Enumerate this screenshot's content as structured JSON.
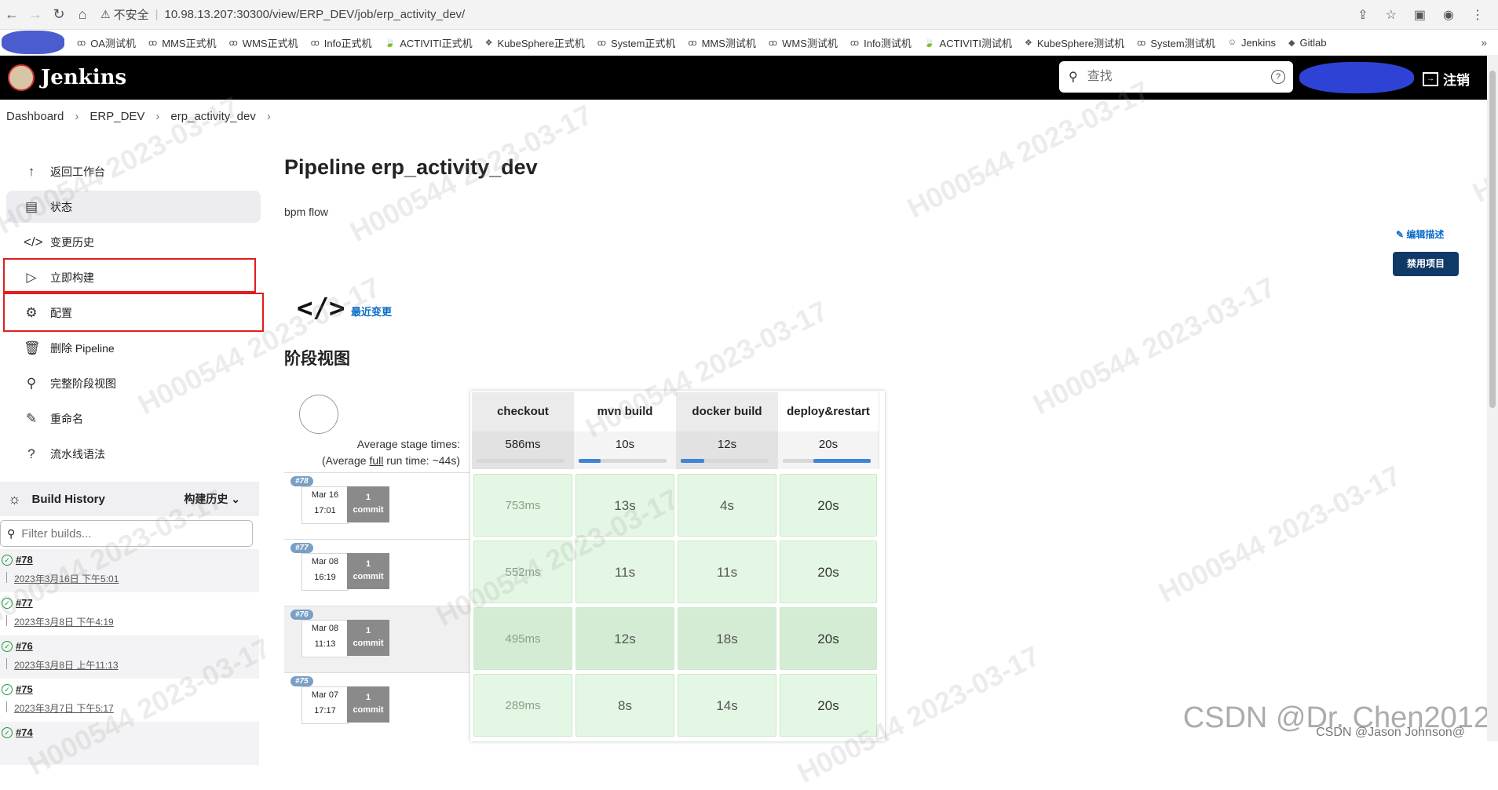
{
  "browser": {
    "insecure_label": "不安全",
    "url": "10.98.13.207:30300/view/ERP_DEV/job/erp_activity_dev/"
  },
  "bookmarks": [
    {
      "label": "OA测试机",
      "icon": "ꝏ"
    },
    {
      "label": "MMS正式机",
      "icon": "ꝏ"
    },
    {
      "label": "WMS正式机",
      "icon": "ꝏ"
    },
    {
      "label": "Info正式机",
      "icon": "ꝏ"
    },
    {
      "label": "ACTIVITI正式机",
      "icon": "🍃"
    },
    {
      "label": "KubeSphere正式机",
      "icon": "❖"
    },
    {
      "label": "System正式机",
      "icon": "ꝏ"
    },
    {
      "label": "MMS测试机",
      "icon": "ꝏ"
    },
    {
      "label": "WMS测试机",
      "icon": "ꝏ"
    },
    {
      "label": "Info测试机",
      "icon": "ꝏ"
    },
    {
      "label": "ACTIVITI测试机",
      "icon": "🍃"
    },
    {
      "label": "KubeSphere测试机",
      "icon": "❖"
    },
    {
      "label": "System测试机",
      "icon": "ꝏ"
    },
    {
      "label": "Jenkins",
      "icon": "☺"
    },
    {
      "label": "Gitlab",
      "icon": "◆"
    }
  ],
  "header": {
    "brand": "Jenkins",
    "search_placeholder": "查找",
    "logout": "注销"
  },
  "breadcrumb": [
    "Dashboard",
    "ERP_DEV",
    "erp_activity_dev"
  ],
  "sidebar": {
    "items": [
      {
        "label": "返回工作台",
        "icon": "↑",
        "name": "back-to-dashboard"
      },
      {
        "label": "状态",
        "icon": "▤",
        "name": "status"
      },
      {
        "label": "变更历史",
        "icon": "</>",
        "name": "changes"
      },
      {
        "label": "立即构建",
        "icon": "▷",
        "name": "build-now"
      },
      {
        "label": "配置",
        "icon": "⚙",
        "name": "configure"
      },
      {
        "label": "删除 Pipeline",
        "icon": "🗑",
        "name": "delete-pipeline"
      },
      {
        "label": "完整阶段视图",
        "icon": "⚲",
        "name": "full-stage-view"
      },
      {
        "label": "重命名",
        "icon": "✎",
        "name": "rename"
      },
      {
        "label": "流水线语法",
        "icon": "?",
        "name": "pipeline-syntax"
      }
    ]
  },
  "build_history": {
    "title": "Build History",
    "trend": "构建历史",
    "filter_placeholder": "Filter builds...",
    "builds": [
      {
        "num": "#78",
        "date": "2023年3月16日 下午5:01"
      },
      {
        "num": "#77",
        "date": "2023年3月8日 下午4:19"
      },
      {
        "num": "#76",
        "date": "2023年3月8日 上午11:13"
      },
      {
        "num": "#75",
        "date": "2023年3月7日 下午5:17"
      },
      {
        "num": "#74",
        "date": ""
      }
    ]
  },
  "main": {
    "title": "Pipeline erp_activity_dev",
    "description": "bpm flow",
    "edit_description": "编辑描述",
    "disable_project": "禁用项目",
    "recent_changes": "最近变更",
    "stage_view_title": "阶段视图"
  },
  "stage_view": {
    "avg_label_1": "Average stage times:",
    "avg_label_2_pre": "(Average ",
    "avg_label_2_link": "full",
    "avg_label_2_post": " run time: ~44s)",
    "stages": [
      "checkout",
      "mvn build",
      "docker build",
      "deploy&restart"
    ],
    "averages": [
      "586ms",
      "10s",
      "12s",
      "20s"
    ],
    "average_fill": [
      0,
      0.25,
      0.27,
      0.65
    ],
    "runs": [
      {
        "badge": "#78",
        "month_day": "Mar 16",
        "time": "17:01",
        "commit_count": "1",
        "commit_label": "commit",
        "durations": [
          "753ms",
          "13s",
          "4s",
          "20s"
        ]
      },
      {
        "badge": "#77",
        "month_day": "Mar 08",
        "time": "16:19",
        "commit_count": "1",
        "commit_label": "commit",
        "durations": [
          "552ms",
          "11s",
          "11s",
          "20s"
        ]
      },
      {
        "badge": "#76",
        "month_day": "Mar 08",
        "time": "11:13",
        "commit_count": "1",
        "commit_label": "commit",
        "durations": [
          "495ms",
          "12s",
          "18s",
          "20s"
        ]
      },
      {
        "badge": "#75",
        "month_day": "Mar 07",
        "time": "17:17",
        "commit_count": "1",
        "commit_label": "commit",
        "durations": [
          "289ms",
          "8s",
          "14s",
          "20s"
        ]
      }
    ]
  },
  "watermark": "H000544 2023-03-17",
  "footer": {
    "csdn": "CSDN @Dr. Chen2012",
    "csdn_user": "CSDN @Jason Johnson@"
  }
}
